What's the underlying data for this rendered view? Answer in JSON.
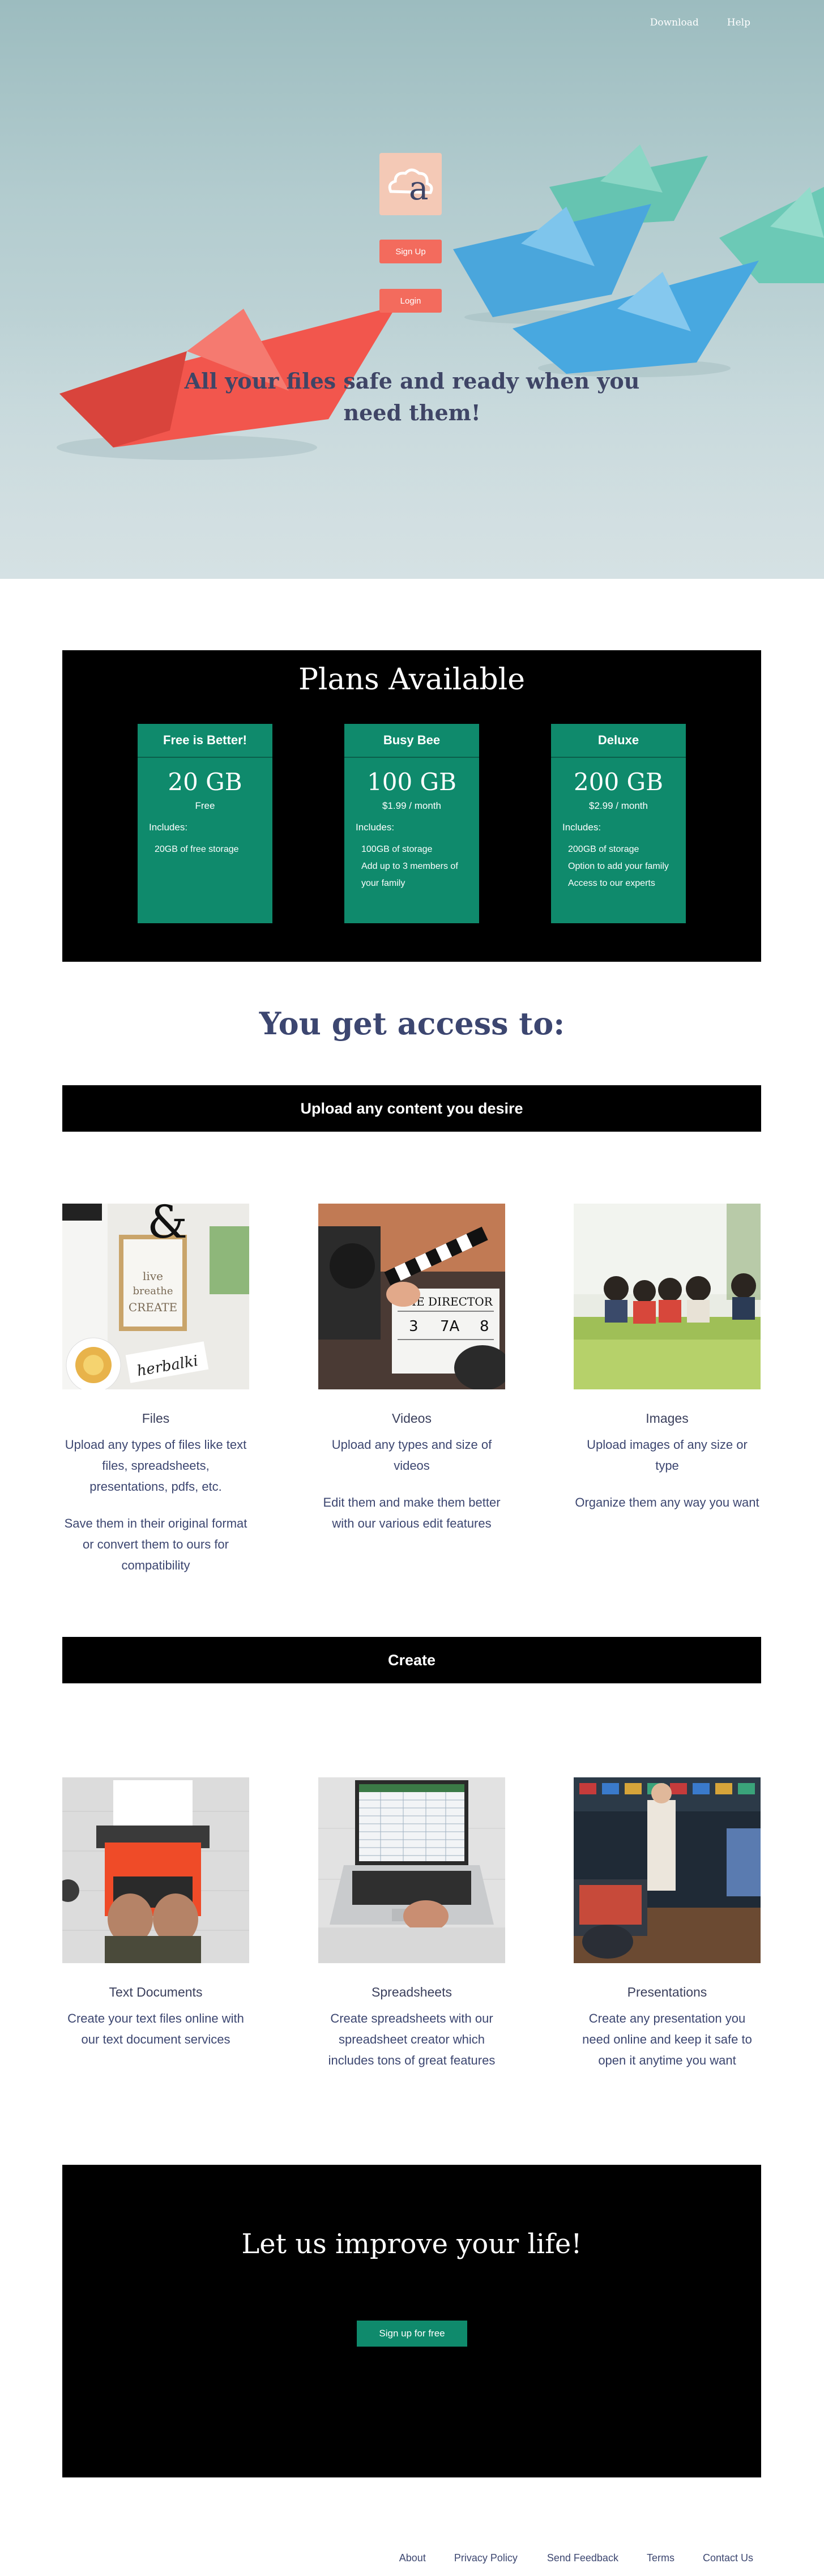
{
  "nav": {
    "download": "Download",
    "help": "Help"
  },
  "hero": {
    "logo_letter": "a",
    "signup_label": "Sign Up",
    "login_label": "Login",
    "title": "All your files safe and ready when you need them!"
  },
  "plans": {
    "heading": "Plans Available",
    "items": [
      {
        "name": "Free is Better!",
        "size": "20 GB",
        "price": "Free",
        "includes": "Includes:",
        "features": [
          "20GB of free storage"
        ]
      },
      {
        "name": "Busy Bee",
        "size": "100 GB",
        "price": "$1.99 / month",
        "includes": "Includes:",
        "features": [
          "100GB of storage",
          "Add up to 3 members of your family"
        ]
      },
      {
        "name": "Deluxe",
        "size": "200 GB",
        "price": "$2.99 / month",
        "includes": "Includes:",
        "features": [
          "200GB of storage",
          "Option to add your family",
          "Access to our experts"
        ]
      }
    ]
  },
  "access": {
    "heading": "You get access to:",
    "upload_bar": "Upload any content you desire",
    "upload_cards": [
      {
        "title": "Files",
        "desc": "Upload any types of files like text files, spreadsheets, presentations, pdfs, etc.",
        "desc2": "Save them in their original format or convert them to ours for compatibility"
      },
      {
        "title": "Videos",
        "desc": "Upload any types and size of videos",
        "desc2": "Edit them and make them better with our various edit features"
      },
      {
        "title": "Images",
        "desc": "Upload images of any size or type",
        "desc2": "Organize them any way you want"
      }
    ],
    "create_bar": "Create",
    "create_cards": [
      {
        "title": "Text Documents",
        "desc": "Create your text files online with our text document services"
      },
      {
        "title": "Spreadsheets",
        "desc": "Create spreadsheets with our spreadsheet creator which includes tons of great features"
      },
      {
        "title": "Presentations",
        "desc": "Create any presentation you need online and keep it safe to open it anytime you want"
      }
    ]
  },
  "photo_text": {
    "ampersand": "&",
    "poster_lines": [
      "live",
      "breathe",
      "CREATE"
    ],
    "herbalki": "herbalki",
    "clapper_title": "THE DIRECTOR",
    "clapper_numbers": [
      "3",
      "7A",
      "8"
    ]
  },
  "cta": {
    "heading": "Let us improve your life!",
    "button": "Sign up for free"
  },
  "footer": {
    "about": "About",
    "privacy": "Privacy Policy",
    "feedback": "Send Feedback",
    "terms": "Terms",
    "contact": "Contact Us"
  },
  "colors": {
    "accent_green": "#0f8a6c",
    "coral": "#f36b5d",
    "logo_bg": "#f4c9b6",
    "text_navy": "#3c4670"
  }
}
